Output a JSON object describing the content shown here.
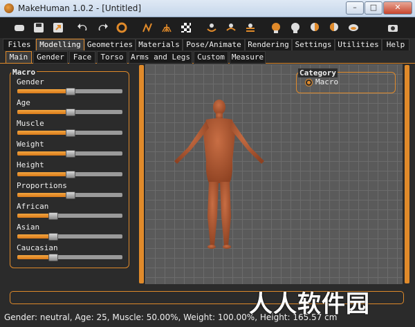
{
  "window": {
    "title": "MakeHuman 1.0.2 - [Untitled]",
    "min": "–",
    "max": "□",
    "close": "✕"
  },
  "toolbar": {
    "icons": [
      "new-file-icon",
      "save-icon",
      "export-icon",
      "undo-icon",
      "redo-icon",
      "reset-icon",
      "wireframe-icon",
      "grid-mesh-icon",
      "checker-icon",
      "front-view-icon",
      "back-view-icon",
      "side-view-icon",
      "face-front-icon",
      "face-left-icon",
      "face-right-icon",
      "face-top-icon",
      "face-bottom-icon",
      "screenshot-icon"
    ],
    "accent": "#e08a2a"
  },
  "menu_tabs": [
    "Files",
    "Modelling",
    "Geometries",
    "Materials",
    "Pose/Animate",
    "Rendering",
    "Settings",
    "Utilities",
    "Help"
  ],
  "active_menu_tab": "Modelling",
  "sub_tabs": [
    "Main",
    "Gender",
    "Face",
    "Torso",
    "Arms and Legs",
    "Custom",
    "Measure"
  ],
  "active_sub_tab": "Main",
  "left_panel": {
    "title": "Macro",
    "sliders": [
      {
        "label": "Gender",
        "value": 0.5
      },
      {
        "label": "Age",
        "value": 0.5
      },
      {
        "label": "Muscle",
        "value": 0.5
      },
      {
        "label": "Weight",
        "value": 0.5
      },
      {
        "label": "Height",
        "value": 0.5
      },
      {
        "label": "Proportions",
        "value": 0.5
      },
      {
        "label": "African",
        "value": 0.333
      },
      {
        "label": "Asian",
        "value": 0.333
      },
      {
        "label": "Caucasian",
        "value": 0.333
      }
    ]
  },
  "right_panel": {
    "title": "Category",
    "options": [
      {
        "label": "Macro",
        "selected": true
      }
    ]
  },
  "viewport": {
    "model_color": "#b25a34",
    "grid_bg": "#5a5a5a"
  },
  "status_bar": {
    "text": "Gender: neutral, Age: 25, Muscle: 50.00%, Weight: 100.00%, Height: 165.57 cm"
  },
  "watermark": {
    "text": "人人软件园"
  }
}
